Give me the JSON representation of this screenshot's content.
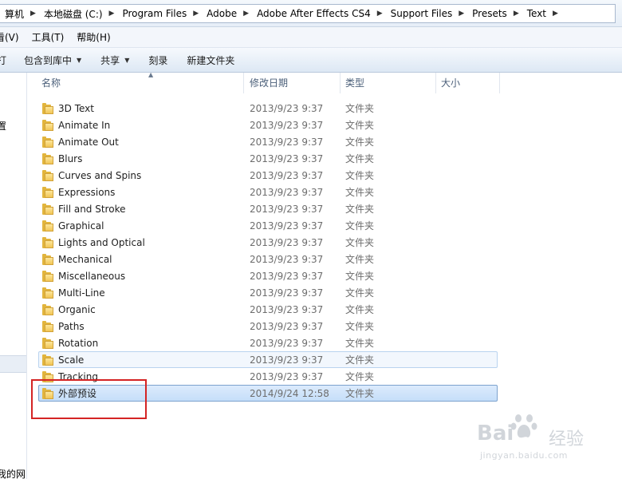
{
  "breadcrumbs": [
    "算机",
    "本地磁盘 (C:)",
    "Program Files",
    "Adobe",
    "Adobe After Effects CS4",
    "Support Files",
    "Presets",
    "Text"
  ],
  "menu": [
    "看(V)",
    "工具(T)",
    "帮助(H)"
  ],
  "toolbar": {
    "organize_fragment": "打",
    "include_library": "包含到库中",
    "share": "共享",
    "burn": "刻录",
    "new_folder": "新建文件夹"
  },
  "nav_fragments": [
    "置",
    "我的网"
  ],
  "columns": {
    "name": "名称",
    "modified": "修改日期",
    "type": "类型",
    "size": "大小"
  },
  "files": [
    {
      "name": "3D Text",
      "modified": "2013/9/23 9:37",
      "type": "文件夹",
      "state": "normal"
    },
    {
      "name": "Animate In",
      "modified": "2013/9/23 9:37",
      "type": "文件夹",
      "state": "normal"
    },
    {
      "name": "Animate Out",
      "modified": "2013/9/23 9:37",
      "type": "文件夹",
      "state": "normal"
    },
    {
      "name": "Blurs",
      "modified": "2013/9/23 9:37",
      "type": "文件夹",
      "state": "normal"
    },
    {
      "name": "Curves and Spins",
      "modified": "2013/9/23 9:37",
      "type": "文件夹",
      "state": "normal"
    },
    {
      "name": "Expressions",
      "modified": "2013/9/23 9:37",
      "type": "文件夹",
      "state": "normal"
    },
    {
      "name": "Fill and Stroke",
      "modified": "2013/9/23 9:37",
      "type": "文件夹",
      "state": "normal"
    },
    {
      "name": "Graphical",
      "modified": "2013/9/23 9:37",
      "type": "文件夹",
      "state": "normal"
    },
    {
      "name": "Lights and Optical",
      "modified": "2013/9/23 9:37",
      "type": "文件夹",
      "state": "normal"
    },
    {
      "name": "Mechanical",
      "modified": "2013/9/23 9:37",
      "type": "文件夹",
      "state": "normal"
    },
    {
      "name": "Miscellaneous",
      "modified": "2013/9/23 9:37",
      "type": "文件夹",
      "state": "normal"
    },
    {
      "name": "Multi-Line",
      "modified": "2013/9/23 9:37",
      "type": "文件夹",
      "state": "normal"
    },
    {
      "name": "Organic",
      "modified": "2013/9/23 9:37",
      "type": "文件夹",
      "state": "normal"
    },
    {
      "name": "Paths",
      "modified": "2013/9/23 9:37",
      "type": "文件夹",
      "state": "normal"
    },
    {
      "name": "Rotation",
      "modified": "2013/9/23 9:37",
      "type": "文件夹",
      "state": "normal"
    },
    {
      "name": "Scale",
      "modified": "2013/9/23 9:37",
      "type": "文件夹",
      "state": "hover"
    },
    {
      "name": "Tracking",
      "modified": "2013/9/23 9:37",
      "type": "文件夹",
      "state": "normal"
    },
    {
      "name": "外部预设",
      "modified": "2014/9/24 12:58",
      "type": "文件夹",
      "state": "selected"
    }
  ],
  "watermark": {
    "logo": "Bai",
    "logo_cn": "经验",
    "url": "jingyan.baidu.com"
  }
}
